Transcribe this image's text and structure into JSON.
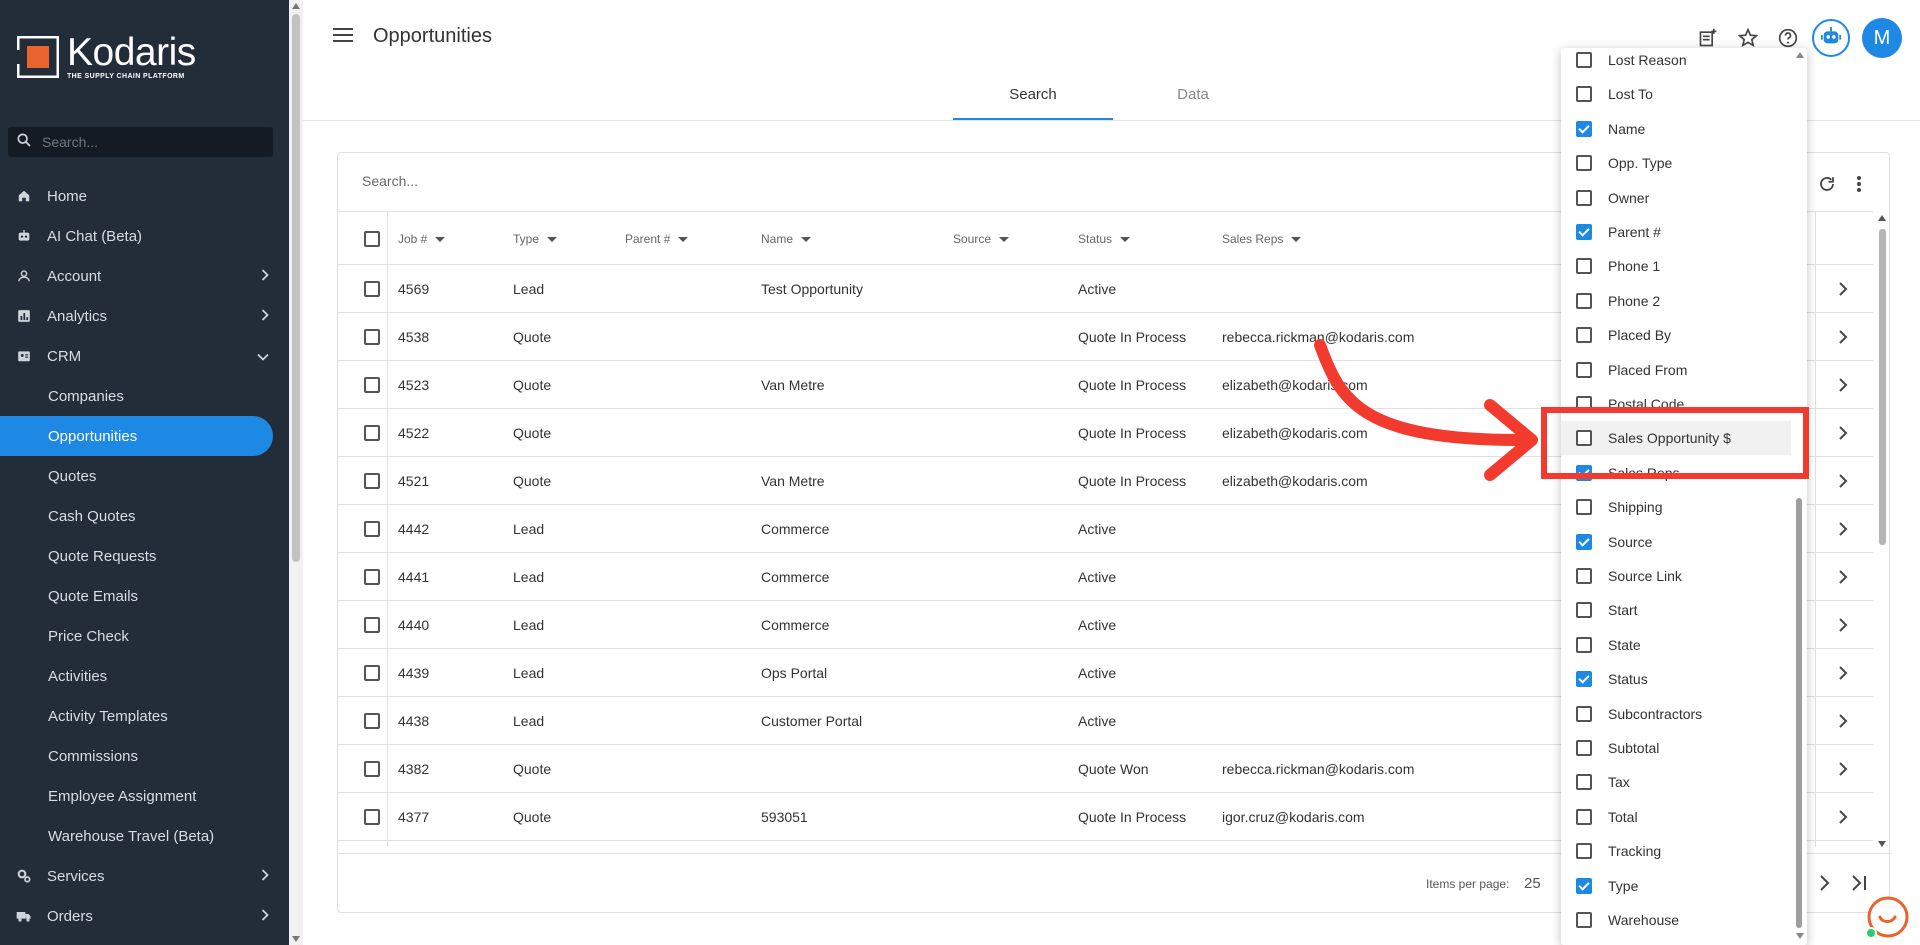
{
  "app": {
    "name": "Kodaris",
    "tagline": "THE SUPPLY CHAIN PLATFORM",
    "brand_color": "#e8642c",
    "accent_color": "#1e88e5",
    "sidebar_bg": "#232c39"
  },
  "sidebar": {
    "search_placeholder": "Search...",
    "items": [
      {
        "label": "Home",
        "icon": "home-icon"
      },
      {
        "label": "AI Chat (Beta)",
        "icon": "robot-icon"
      },
      {
        "label": "Account",
        "icon": "person-icon",
        "expandable": true
      },
      {
        "label": "Analytics",
        "icon": "analytics-icon",
        "expandable": true
      },
      {
        "label": "CRM",
        "icon": "crm-icon",
        "expanded": true
      },
      {
        "label": "Companies",
        "sub": true
      },
      {
        "label": "Opportunities",
        "sub": true,
        "active": true
      },
      {
        "label": "Quotes",
        "sub": true
      },
      {
        "label": "Cash Quotes",
        "sub": true
      },
      {
        "label": "Quote Requests",
        "sub": true
      },
      {
        "label": "Quote Emails",
        "sub": true
      },
      {
        "label": "Price Check",
        "sub": true
      },
      {
        "label": "Activities",
        "sub": true
      },
      {
        "label": "Activity Templates",
        "sub": true
      },
      {
        "label": "Commissions",
        "sub": true
      },
      {
        "label": "Employee Assignment",
        "sub": true
      },
      {
        "label": "Warehouse Travel (Beta)",
        "sub": true
      },
      {
        "label": "Services",
        "icon": "services-icon",
        "expandable": true
      },
      {
        "label": "Orders",
        "icon": "truck-icon",
        "expandable": true
      }
    ]
  },
  "header": {
    "title": "Opportunities",
    "tabs": [
      {
        "label": "Search",
        "active": true
      },
      {
        "label": "Data",
        "active": false
      }
    ],
    "avatar_letter": "M"
  },
  "table": {
    "search_placeholder": "Search...",
    "columns": [
      "Job #",
      "Type",
      "Parent #",
      "Name",
      "Source",
      "Status",
      "Sales Reps"
    ],
    "rows": [
      {
        "job": "4569",
        "type": "Lead",
        "parent": "",
        "name": "Test Opportunity",
        "source": "",
        "status": "Active",
        "reps": ""
      },
      {
        "job": "4538",
        "type": "Quote",
        "parent": "",
        "name": "",
        "source": "",
        "status": "Quote In Process",
        "reps": "rebecca.rickman@kodaris.com"
      },
      {
        "job": "4523",
        "type": "Quote",
        "parent": "",
        "name": "Van Metre",
        "source": "",
        "status": "Quote In Process",
        "reps": "elizabeth@kodaris.com"
      },
      {
        "job": "4522",
        "type": "Quote",
        "parent": "",
        "name": "",
        "source": "",
        "status": "Quote In Process",
        "reps": "elizabeth@kodaris.com"
      },
      {
        "job": "4521",
        "type": "Quote",
        "parent": "",
        "name": "Van Metre",
        "source": "",
        "status": "Quote In Process",
        "reps": "elizabeth@kodaris.com"
      },
      {
        "job": "4442",
        "type": "Lead",
        "parent": "",
        "name": "Commerce",
        "source": "",
        "status": "Active",
        "reps": ""
      },
      {
        "job": "4441",
        "type": "Lead",
        "parent": "",
        "name": "Commerce",
        "source": "",
        "status": "Active",
        "reps": ""
      },
      {
        "job": "4440",
        "type": "Lead",
        "parent": "",
        "name": "Commerce",
        "source": "",
        "status": "Active",
        "reps": ""
      },
      {
        "job": "4439",
        "type": "Lead",
        "parent": "",
        "name": "Ops Portal",
        "source": "",
        "status": "Active",
        "reps": ""
      },
      {
        "job": "4438",
        "type": "Lead",
        "parent": "",
        "name": "Customer Portal",
        "source": "",
        "status": "Active",
        "reps": ""
      },
      {
        "job": "4382",
        "type": "Quote",
        "parent": "",
        "name": "",
        "source": "",
        "status": "Quote Won",
        "reps": "rebecca.rickman@kodaris.com"
      },
      {
        "job": "4377",
        "type": "Quote",
        "parent": "",
        "name": "593051",
        "source": "",
        "status": "Quote In Process",
        "reps": "igor.cruz@kodaris.com"
      }
    ],
    "pager": {
      "label": "Items per page:",
      "size": "25"
    }
  },
  "column_chooser": {
    "items": [
      {
        "label": "Lost Reason",
        "checked": false
      },
      {
        "label": "Lost To",
        "checked": false
      },
      {
        "label": "Name",
        "checked": true
      },
      {
        "label": "Opp. Type",
        "checked": false
      },
      {
        "label": "Owner",
        "checked": false
      },
      {
        "label": "Parent #",
        "checked": true
      },
      {
        "label": "Phone 1",
        "checked": false
      },
      {
        "label": "Phone 2",
        "checked": false
      },
      {
        "label": "Placed By",
        "checked": false
      },
      {
        "label": "Placed From",
        "checked": false
      },
      {
        "label": "Postal Code",
        "checked": false
      },
      {
        "label": "Sales Opportunity $",
        "checked": false,
        "highlighted": true
      },
      {
        "label": "Sales Reps",
        "checked": true
      },
      {
        "label": "Shipping",
        "checked": false
      },
      {
        "label": "Source",
        "checked": true
      },
      {
        "label": "Source Link",
        "checked": false
      },
      {
        "label": "Start",
        "checked": false
      },
      {
        "label": "State",
        "checked": false
      },
      {
        "label": "Status",
        "checked": true
      },
      {
        "label": "Subcontractors",
        "checked": false
      },
      {
        "label": "Subtotal",
        "checked": false
      },
      {
        "label": "Tax",
        "checked": false
      },
      {
        "label": "Total",
        "checked": false
      },
      {
        "label": "Tracking",
        "checked": false
      },
      {
        "label": "Type",
        "checked": true
      },
      {
        "label": "Warehouse",
        "checked": false
      }
    ]
  },
  "annotation": {
    "color": "#f23a2e"
  }
}
